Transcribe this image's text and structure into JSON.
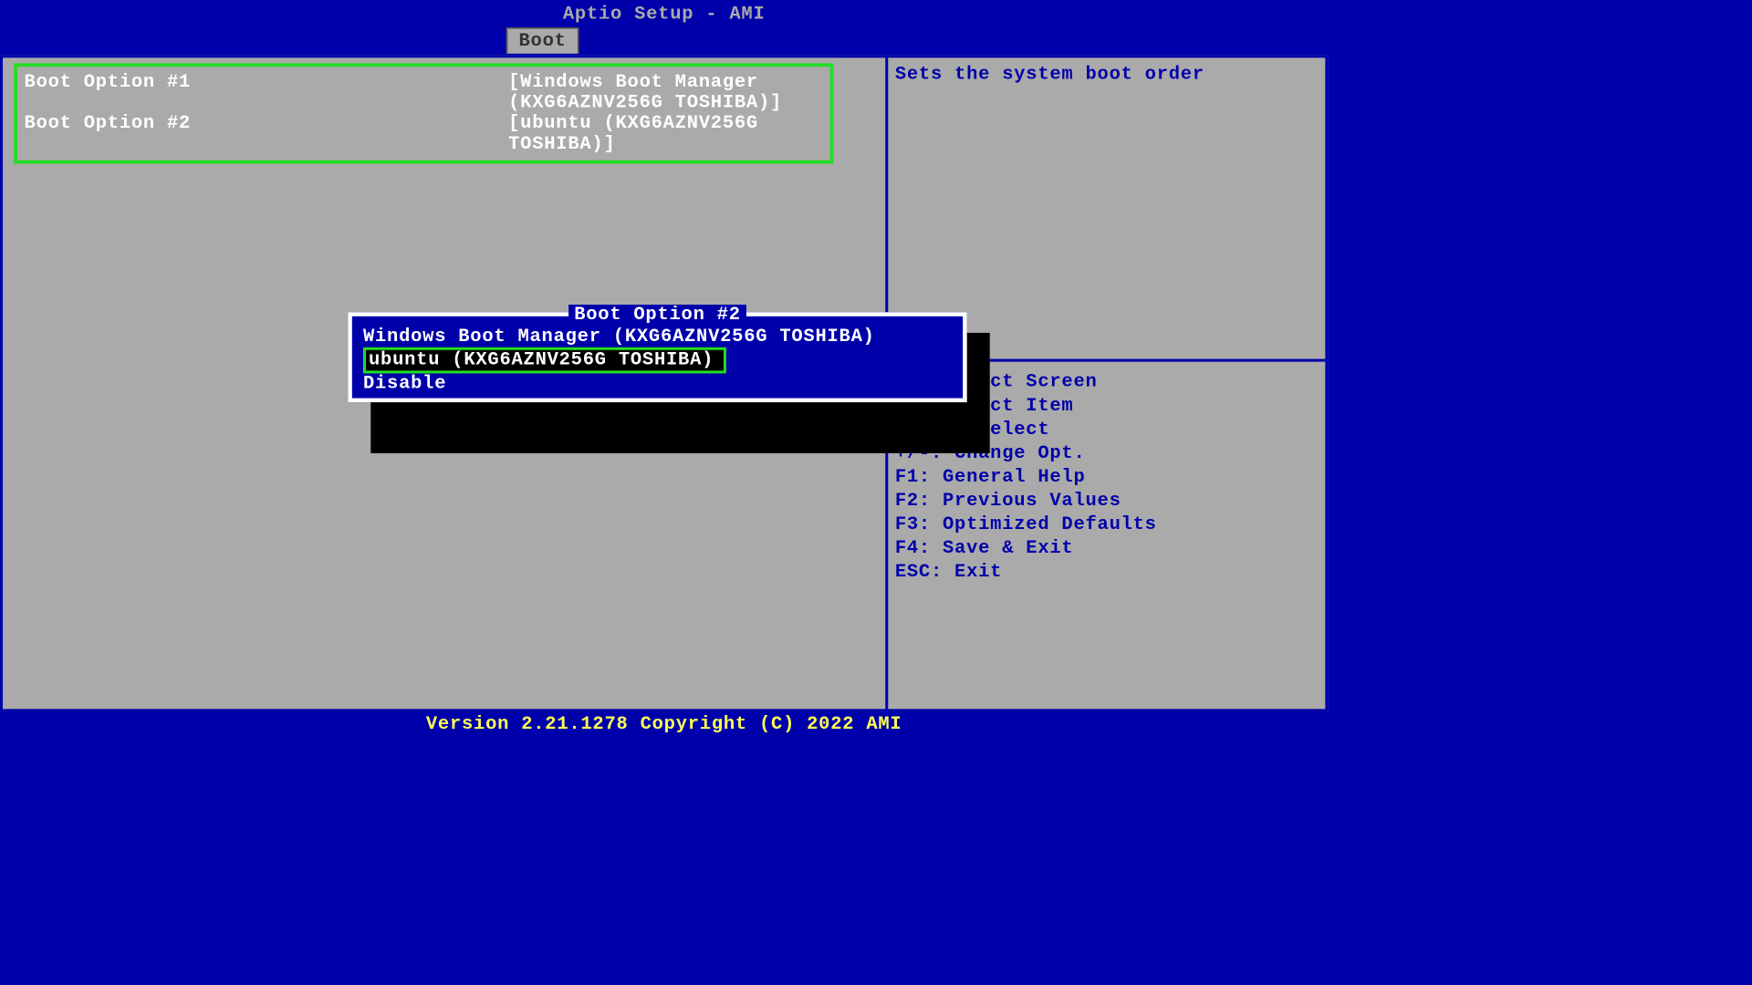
{
  "header": {
    "title": "Aptio Setup - AMI"
  },
  "tab": {
    "label": "Boot"
  },
  "boot_options": {
    "option1": {
      "label": "Boot Option #1",
      "value": "[Windows Boot Manager (KXG6AZNV256G TOSHIBA)]"
    },
    "option2": {
      "label": "Boot Option #2",
      "value": "[ubuntu (KXG6AZNV256G TOSHIBA)]"
    }
  },
  "help": {
    "description": "Sets the system boot order"
  },
  "keys": {
    "k1": "→←: Select Screen",
    "k2": "↑↓: Select Item",
    "k3": "Enter: Select",
    "k4": "+/-: Change Opt.",
    "k5": "F1: General Help",
    "k6": "F2: Previous Values",
    "k7": "F3: Optimized Defaults",
    "k8": "F4: Save & Exit",
    "k9": "ESC: Exit"
  },
  "popup": {
    "title": "Boot Option #2",
    "options": [
      "Windows Boot Manager (KXG6AZNV256G TOSHIBA)",
      "ubuntu (KXG6AZNV256G TOSHIBA)",
      "Disable"
    ],
    "selected_index": 1
  },
  "footer": {
    "text": "Version 2.21.1278 Copyright (C) 2022 AMI"
  }
}
